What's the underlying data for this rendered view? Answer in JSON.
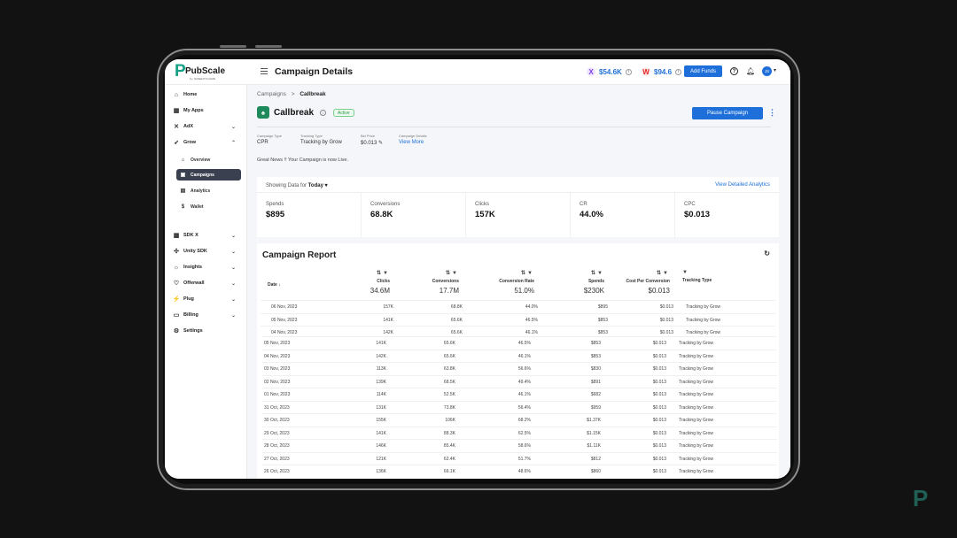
{
  "app": {
    "logo_text": "PubScale",
    "logo_sub": "by GREEDYGAME",
    "page_title": "Campaign Details",
    "wallets": [
      {
        "icon": "X",
        "value": "$54.6K",
        "color": "#7b3fe4"
      },
      {
        "icon": "W",
        "value": "$94.6",
        "color": "#e02424"
      }
    ],
    "add_funds_label": "Add Funds",
    "avatar_initials": "JS"
  },
  "sidebar": {
    "items": [
      {
        "label": "Home",
        "icon": "home-icon",
        "glyph": "⌂"
      },
      {
        "label": "My Apps",
        "icon": "apps-icon",
        "glyph": "▦"
      },
      {
        "label": "AdX",
        "icon": "adx-icon",
        "glyph": "✕"
      },
      {
        "label": "Grow",
        "icon": "rocket-icon",
        "glyph": "➶"
      }
    ],
    "sub_items": [
      {
        "label": "Overview",
        "icon": "home-icon",
        "glyph": "⌂"
      },
      {
        "label": "Campaigns",
        "icon": "campaign-icon",
        "glyph": "▣"
      },
      {
        "label": "Analytics",
        "icon": "chart-icon",
        "glyph": "▤"
      },
      {
        "label": "Wallet",
        "icon": "wallet-icon",
        "glyph": "$"
      }
    ],
    "items2": [
      {
        "label": "SDK X",
        "icon": "sdk-icon",
        "glyph": "▩"
      },
      {
        "label": "Unity SDK",
        "icon": "unity-icon",
        "glyph": "✣"
      },
      {
        "label": "Insights",
        "icon": "bulb-icon",
        "glyph": "☼"
      },
      {
        "label": "Offerwall",
        "icon": "heart-icon",
        "glyph": "♡"
      },
      {
        "label": "Plug",
        "icon": "plug-icon",
        "glyph": "⚡"
      },
      {
        "label": "Billing",
        "icon": "billing-icon",
        "glyph": "▭"
      },
      {
        "label": "Settings",
        "icon": "gear-icon",
        "glyph": "⚙"
      }
    ]
  },
  "campaign": {
    "breadcrumb_parent": "Campaigns",
    "breadcrumb_sep": ">",
    "breadcrumb_current": "Callbreak",
    "name": "Callbreak",
    "status": "Active",
    "pause_label": "Pause Campaign",
    "meta": [
      {
        "label": "Campaign Type",
        "value": "CPR"
      },
      {
        "label": "Tracking Type",
        "value": "Tracking by Grow"
      },
      {
        "label": "Bid Price",
        "value": "$0.013 ✎"
      },
      {
        "label": "Campaign Details",
        "value": "View More"
      }
    ],
    "news": "Great News !! Your Campaign is now Live."
  },
  "showing": {
    "prefix": "Showing Data for",
    "period": "Today ▾",
    "link": "View Detailed Analytics"
  },
  "stats": [
    {
      "label": "Spends",
      "value": "$895"
    },
    {
      "label": "Conversions",
      "value": "68.8K"
    },
    {
      "label": "Clicks",
      "value": "157K"
    },
    {
      "label": "CR",
      "value": "44.0%"
    },
    {
      "label": "CPC",
      "value": "$0.013"
    }
  ],
  "report": {
    "title": "Campaign Report",
    "headers": {
      "date": "Date ↓",
      "clicks": "Clicks",
      "conversions": "Conversions",
      "cr": "Conversion Rate",
      "spends": "Spends",
      "cpc": "Cost Per Conversion",
      "tracking": "Tracking Type"
    },
    "totals": {
      "clicks": "34.6M",
      "conversions": "17.7M",
      "cr": "51.0%",
      "spends": "$230K",
      "cpc": "$0.013"
    },
    "rows": [
      [
        "06 Nov, 2023",
        "157K",
        "68.8K",
        "44.0%",
        "$895",
        "$0.013",
        "Tracking by Grow"
      ],
      [
        "05 Nov, 2023",
        "141K",
        "65.6K",
        "46.5%",
        "$853",
        "$0.013",
        "Tracking by Grow"
      ],
      [
        "04 Nov, 2023",
        "142K",
        "65.6K",
        "46.1%",
        "$853",
        "$0.013",
        "Tracking by Grow"
      ]
    ],
    "overflow_rows": [
      [
        "05 Nov, 2023",
        "141K",
        "65.6K",
        "46.5%",
        "$853",
        "$0.013",
        "Tracking by Grow"
      ],
      [
        "04 Nov, 2023",
        "142K",
        "65.6K",
        "46.1%",
        "$853",
        "$0.013",
        "Tracking by Grow"
      ],
      [
        "03 Nov, 2023",
        "113K",
        "63.8K",
        "56.6%",
        "$830",
        "$0.013",
        "Tracking by Grow"
      ],
      [
        "02 Nov, 2023",
        "139K",
        "68.5K",
        "49.4%",
        "$891",
        "$0.013",
        "Tracking by Grow"
      ],
      [
        "01 Nov, 2023",
        "114K",
        "52.5K",
        "46.1%",
        "$682",
        "$0.013",
        "Tracking by Grow"
      ],
      [
        "31 Oct, 2023",
        "131K",
        "73.8K",
        "56.4%",
        "$959",
        "$0.013",
        "Tracking by Grow"
      ],
      [
        "30 Oct, 2023",
        "155K",
        "106K",
        "68.2%",
        "$1.37K",
        "$0.013",
        "Tracking by Grow"
      ],
      [
        "29 Oct, 2023",
        "141K",
        "88.3K",
        "62.5%",
        "$1.15K",
        "$0.013",
        "Tracking by Grow"
      ],
      [
        "28 Oct, 2023",
        "146K",
        "85.4K",
        "58.6%",
        "$1.11K",
        "$0.013",
        "Tracking by Grow"
      ],
      [
        "27 Oct, 2023",
        "121K",
        "62.4K",
        "51.7%",
        "$812",
        "$0.013",
        "Tracking by Grow"
      ],
      [
        "26 Oct, 2023",
        "136K",
        "66.1K",
        "48.6%",
        "$860",
        "$0.013",
        "Tracking by Grow"
      ]
    ]
  },
  "colors": {
    "accent": "#1e6fd9",
    "brand": "#16a085",
    "active_nav": "#3a4050"
  }
}
